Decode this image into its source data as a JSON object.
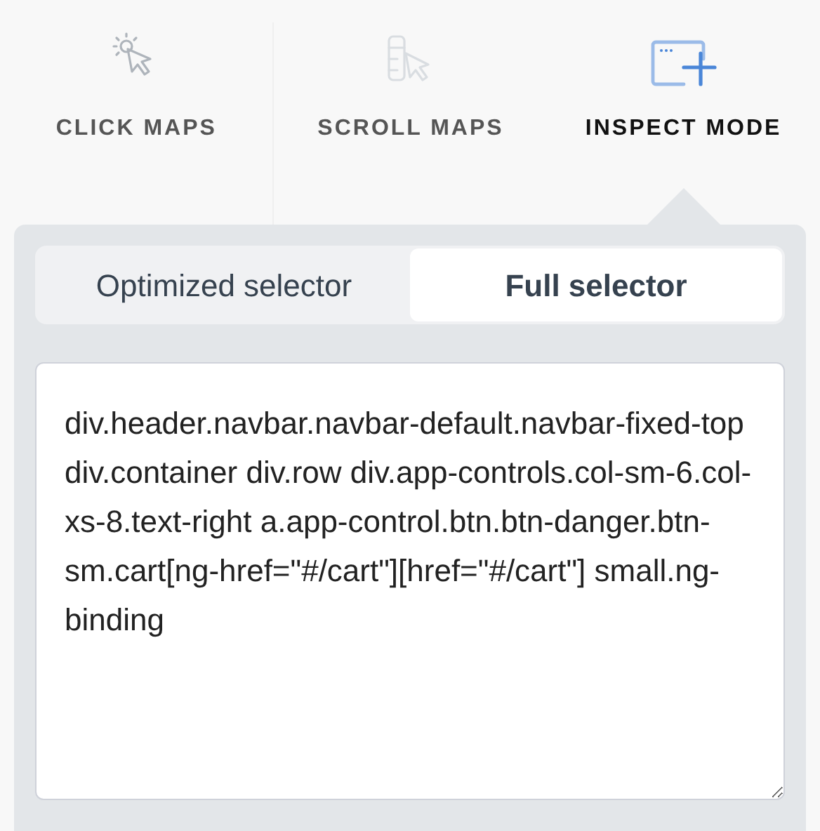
{
  "modes": [
    {
      "label": "CLICK MAPS",
      "kind": "click",
      "selected": false
    },
    {
      "label": "SCROLL MAPS",
      "kind": "scroll",
      "selected": false
    },
    {
      "label": "INSPECT MODE",
      "kind": "inspect",
      "selected": true
    }
  ],
  "selector_tabs": [
    {
      "label": "Optimized selector",
      "selected": false
    },
    {
      "label": "Full selector",
      "selected": true
    }
  ],
  "selector_value": "div.header.navbar.navbar-default.navbar-fixed-top div.container div.row div.app-controls.col-sm-6.col-xs-8.text-right a.app-control.btn.btn-danger.btn-sm.cart[ng-href=\"#/cart\"][href=\"#/cart\"] small.ng-binding"
}
